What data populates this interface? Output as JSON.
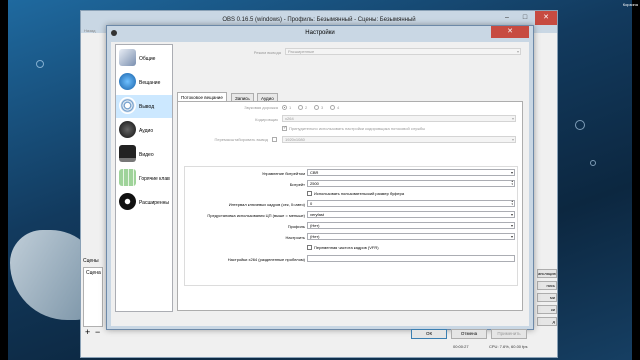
{
  "obs": {
    "title": "OBS 0.16.5 (windows) - Профиль: Безымянный - Сцены: Безымянный",
    "back_label": "Назад",
    "scenes_header": "Сцены",
    "scenes": [
      "Сцена"
    ],
    "right_buttons": [
      "ансляцию",
      "пись",
      "ми",
      "ки",
      "д"
    ],
    "status": {
      "time": "00:00:27",
      "cpu": "CPU: 7.6%, 60.00 fps"
    }
  },
  "settings": {
    "title": "Настройки",
    "categories": [
      {
        "label": "Общие",
        "icon": "general-settings-icon",
        "selected": false
      },
      {
        "label": "Вещание",
        "icon": "stream-globe-icon",
        "selected": false
      },
      {
        "label": "Вывод",
        "icon": "output-broadcast-icon",
        "selected": true
      },
      {
        "label": "Аудио",
        "icon": "speaker-icon",
        "selected": false
      },
      {
        "label": "Видео",
        "icon": "monitor-icon",
        "selected": false
      },
      {
        "label": "Горячие клав",
        "icon": "keyboard-icon",
        "selected": false
      },
      {
        "label": "Расширенны",
        "icon": "gears-icon",
        "selected": false
      }
    ],
    "output_mode_label": "Режим вывода",
    "output_mode_value": "Расширенные",
    "tabs": [
      "Потоковое вещание",
      "Запись",
      "Аудио"
    ],
    "active_tab": 0,
    "audio_track_label": "Звуковая дорожка",
    "audio_tracks": [
      "1",
      "2",
      "3",
      "4"
    ],
    "encoder_label": "Кодировщик",
    "encoder_value": "x264",
    "enforce_label": "Принудительно использовать настройки кодировщика потоковой службы",
    "rescale_label": "Перемасштабировать вывод",
    "rescale_value": "1920x1080",
    "rate_control_label": "Управление битрейтом",
    "rate_control_value": "CBR",
    "bitrate_label": "Битрейт",
    "bitrate_value": "2500",
    "custom_buffer_label": "Использовать пользовательский размер буфера",
    "keyint_label": "Интервал ключевых кадров (сек, 0=авто)",
    "keyint_value": "0",
    "preset_label": "Предустановка использования ЦП (выше = меньше)",
    "preset_value": "veryfast",
    "profile_label": "Профиль",
    "profile_value": "(Нет)",
    "tune_label": "Настроить",
    "tune_value": "(Нет)",
    "vfr_label": "Переменная частота кадров (VFR)",
    "x264opts_label": "Настройки x264 (разделенные пробелом)",
    "x264opts_value": "",
    "buttons": {
      "ok": "ОК",
      "cancel": "Отмена",
      "apply": "Применить"
    }
  },
  "corner_label": "Корзина",
  "colors": {
    "selection": "#cce8ff",
    "close_button": "#c74b41",
    "dialog_frame": "#c9d7e4"
  }
}
